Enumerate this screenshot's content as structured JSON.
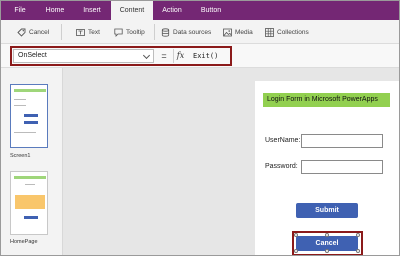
{
  "menubar": {
    "tabs": [
      {
        "label": "File"
      },
      {
        "label": "Home"
      },
      {
        "label": "Insert"
      },
      {
        "label": "Content",
        "active": true
      },
      {
        "label": "Action"
      },
      {
        "label": "Button"
      }
    ]
  },
  "ribbon": {
    "cancel": {
      "label": "Cancel",
      "icon": "tag-icon"
    },
    "text": {
      "label": "Text",
      "icon": "text-label-icon"
    },
    "tooltip": {
      "label": "Tooltip",
      "icon": "tooltip-icon"
    },
    "data_sources": {
      "label": "Data sources",
      "icon": "database-icon"
    },
    "media": {
      "label": "Media",
      "icon": "image-icon"
    },
    "collections": {
      "label": "Collections",
      "icon": "grid-icon"
    }
  },
  "formula_bar": {
    "property": "OnSelect",
    "equals": "=",
    "fx": "fx",
    "formula": "Exit()"
  },
  "screens": [
    {
      "label": "Screen1"
    },
    {
      "label": "HomePage"
    }
  ],
  "form": {
    "title": "Login Form in Microsoft PowerApps",
    "username_label": "UserName:",
    "password_label": "Password:",
    "submit_label": "Submit",
    "cancel_label": "Cancel"
  },
  "colors": {
    "menubar": "#742774",
    "title_bar": "#92d050",
    "button": "#3f61b2",
    "highlight": "#8b1a1a"
  }
}
